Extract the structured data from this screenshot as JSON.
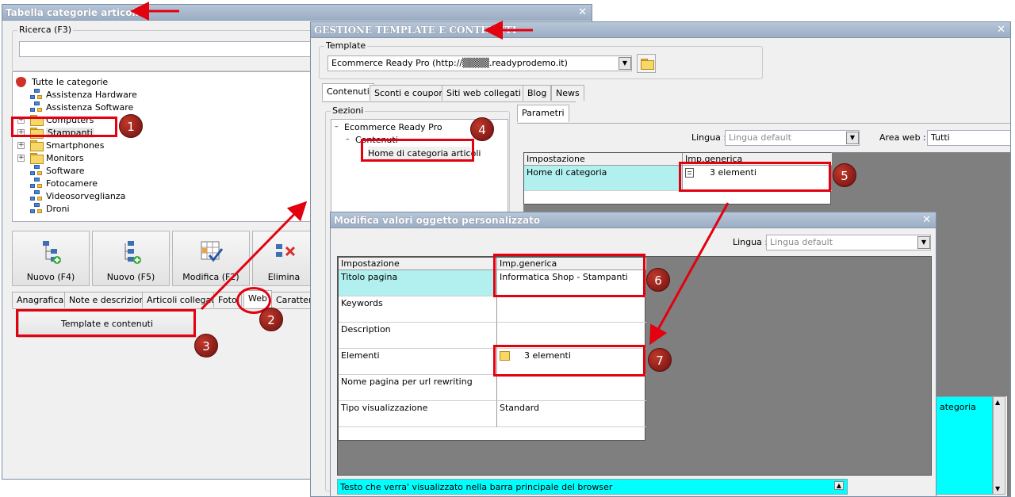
{
  "win1": {
    "title": "Tabella categorie articoli",
    "search_label": "Ricerca (F3)",
    "search_value": "",
    "tree_root": "Tutte le categorie",
    "tree_items": [
      "Assistenza Hardware",
      "Assistenza Software",
      "Computers",
      "Stampanti",
      "Smartphones",
      "Monitors",
      "Software",
      "Fotocamere",
      "Videosorveglianza",
      "Droni"
    ],
    "buttons": [
      "Nuovo (F4)",
      "Nuovo (F5)",
      "Modifica (F2)",
      "Elimina"
    ],
    "tabs": [
      "Anagrafica",
      "Note e descrizioni",
      "Articoli collegati",
      "Foto",
      "Web",
      "Caratteris"
    ],
    "template_button": "Template e contenuti"
  },
  "win2": {
    "title": "GESTIONE TEMPLATE E CONTENUTI",
    "template_label": "Template",
    "template_value": "Ecommerce Ready Pro (http://▒▒▒▒.readyprodemo.it)",
    "tabs": [
      "Contenuti",
      "Sconti e coupon",
      "Siti web collegati",
      "Blog",
      "News"
    ],
    "sezioni_label": "Sezioni",
    "sezioni_tree": [
      "Ecommerce Ready Pro",
      "Contenuti",
      "Home di categoria articoli"
    ],
    "param_tab": "Parametri",
    "lingua_label": "Lingua :",
    "lingua_value": "Lingua default",
    "area_label": "Area web :",
    "area_value": "Tutti",
    "grid_headers": [
      "Impostazione",
      "Imp.generica"
    ],
    "grid_row": {
      "setting": "Home di categoria",
      "value": "3 elementi"
    },
    "side_text": "ategoria"
  },
  "win3": {
    "title": "Modifica valori oggetto personalizzato",
    "lingua_label": "Lingua :",
    "lingua_value": "Lingua default",
    "headers": [
      "Impostazione",
      "Imp.generica"
    ],
    "rows": [
      {
        "label": "Titolo pagina",
        "value": "Informatica Shop - Stampanti"
      },
      {
        "label": "Keywords",
        "value": ""
      },
      {
        "label": "Description",
        "value": ""
      },
      {
        "label": "Elementi",
        "value": "3 elementi"
      },
      {
        "label": "Nome pagina per url rewriting",
        "value": ""
      },
      {
        "label": "Tipo visualizzazione",
        "value": "Standard"
      }
    ],
    "hint": "Testo che verra' visualizzato nella barra principale del browser"
  },
  "annotations": [
    "1",
    "2",
    "3",
    "4",
    "5",
    "6",
    "7"
  ],
  "colors": {
    "highlight": "#e3000f",
    "cyan": "#00ffff",
    "light_cyan": "#b2f0f0",
    "title_bar": "#a9b9cd",
    "badge": "#8b1a1a"
  }
}
